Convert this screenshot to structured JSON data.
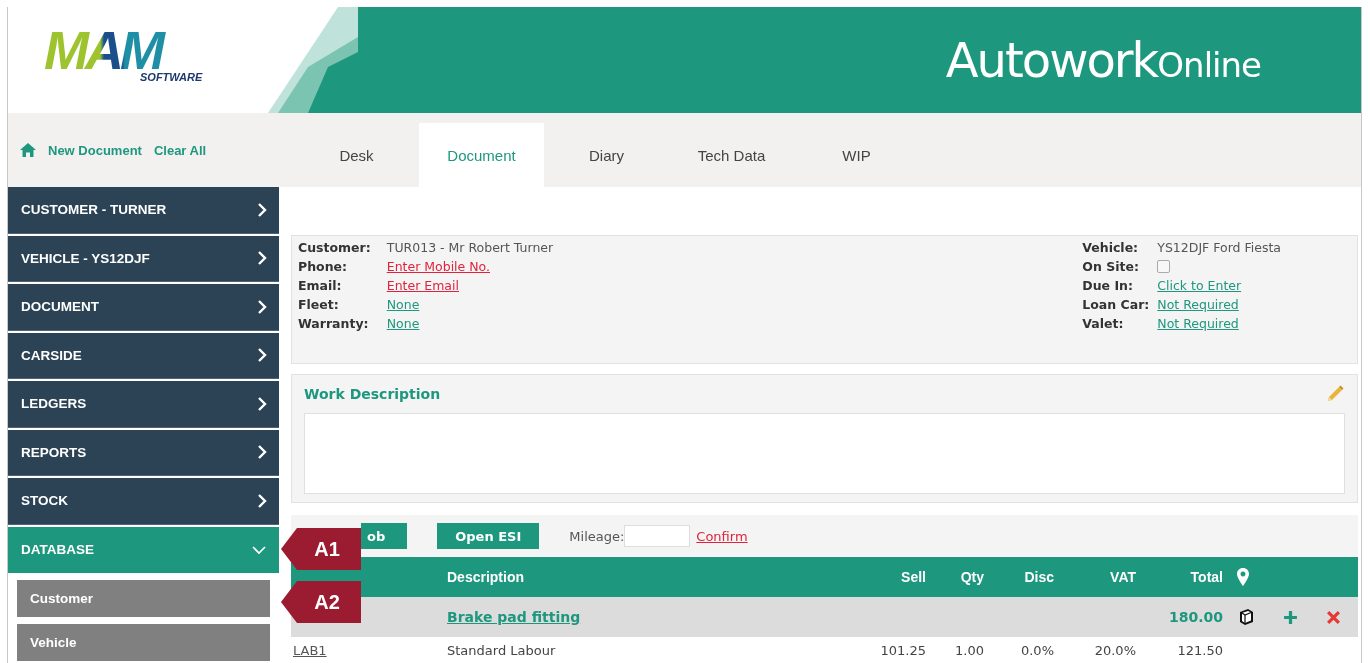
{
  "header": {
    "logo": {
      "mark": "MAM",
      "tagline": "SOFTWARE"
    },
    "title": "Autowork",
    "title_suffix": "Online"
  },
  "nav": {
    "links": [
      "New Document",
      "Clear All"
    ],
    "tabs": [
      {
        "label": "Desk",
        "selected": false
      },
      {
        "label": "Document",
        "selected": true
      },
      {
        "label": "Diary",
        "selected": false
      },
      {
        "label": "Tech Data",
        "selected": false
      },
      {
        "label": "WIP",
        "selected": false
      }
    ]
  },
  "sidebar": {
    "items": [
      {
        "label": "CUSTOMER - TURNER",
        "expanded": false
      },
      {
        "label": "VEHICLE - YS12DJF",
        "expanded": false
      },
      {
        "label": "DOCUMENT",
        "expanded": false
      },
      {
        "label": "CARSIDE",
        "expanded": false
      },
      {
        "label": "LEDGERS",
        "expanded": false
      },
      {
        "label": "REPORTS",
        "expanded": false
      },
      {
        "label": "STOCK",
        "expanded": false
      },
      {
        "label": "DATABASE",
        "expanded": true,
        "children": [
          {
            "label": "Customer"
          },
          {
            "label": "Vehicle"
          }
        ]
      }
    ]
  },
  "details": {
    "left": [
      {
        "label": "Customer:",
        "kind": "text",
        "value": "TUR013 - Mr Robert Turner"
      },
      {
        "label": "Phone:",
        "kind": "alert-link",
        "value": "Enter Mobile No."
      },
      {
        "label": "Email:",
        "kind": "alert-link",
        "value": "Enter Email"
      },
      {
        "label": "Fleet:",
        "kind": "link",
        "value": "None"
      },
      {
        "label": "Warranty:",
        "kind": "link",
        "value": "None"
      }
    ],
    "right": [
      {
        "label": "Vehicle:",
        "kind": "text",
        "value": "YS12DJF Ford Fiesta"
      },
      {
        "label": "On Site:",
        "kind": "checkbox",
        "checked": false
      },
      {
        "label": "Due In:",
        "kind": "link",
        "value": "Click to Enter"
      },
      {
        "label": "Loan Car:",
        "kind": "link",
        "value": "Not Required"
      },
      {
        "label": "Valet:",
        "kind": "link",
        "value": "Not Required"
      }
    ]
  },
  "work_description": {
    "title": "Work Description"
  },
  "toolbar": {
    "buttons": [
      "ob",
      "Open ESI"
    ],
    "mileage_label": "Mileage:",
    "confirm": "Confirm"
  },
  "table": {
    "columns": [
      "Description",
      "Sell",
      "Qty",
      "Disc",
      "VAT",
      "Total"
    ],
    "groups": [
      {
        "title": "Brake pad fitting",
        "total": "180.00",
        "rows": [
          {
            "code": "LAB1",
            "description": "Standard Labour",
            "sell": "101.25",
            "qty": "1.00",
            "disc": "0.0%",
            "vat": "20.0%",
            "total": "121.50"
          }
        ]
      }
    ]
  },
  "callouts": [
    "A1",
    "A2"
  ]
}
